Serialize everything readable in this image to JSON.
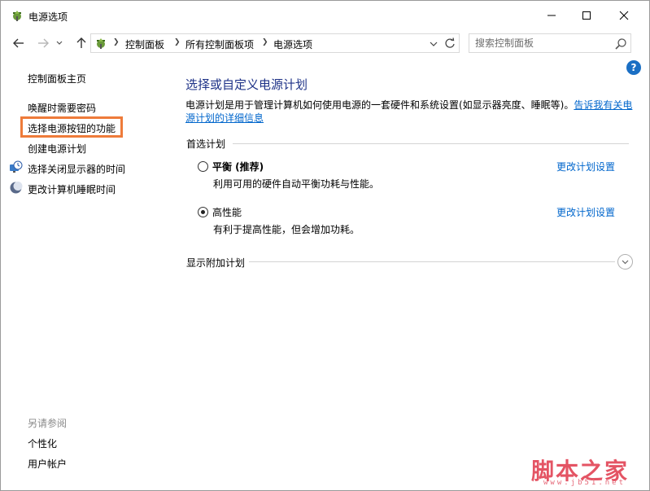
{
  "window": {
    "title": "电源选项",
    "controls": {
      "minimize": "—",
      "maximize": "☐",
      "close": "✕"
    }
  },
  "nav": {
    "breadcrumbs": [
      "控制面板",
      "所有控制面板项",
      "电源选项"
    ],
    "search_placeholder": "搜索控制面板"
  },
  "help": {
    "label": "?"
  },
  "sidebar": {
    "home": "控制面板主页",
    "links": [
      {
        "label": "唤醒时需要密码"
      },
      {
        "label": "选择电源按钮的功能"
      },
      {
        "label": "创建电源计划"
      },
      {
        "label": "选择关闭显示器的时间",
        "icon": "monitor-clock-icon"
      },
      {
        "label": "更改计算机睡眠时间",
        "icon": "moon-icon"
      }
    ],
    "see_also": {
      "heading": "另请参阅",
      "links": [
        "个性化",
        "用户帐户"
      ]
    }
  },
  "main": {
    "title": "选择或自定义电源计划",
    "description": "电源计划是用于管理计算机如何使用电源的一套硬件和系统设置(如显示器亮度、睡眠等)。",
    "description_link": "告诉我有关电源计划的详细信息",
    "preferred_label": "首选计划",
    "plans": [
      {
        "name": "平衡 (推荐)",
        "description": "利用可用的硬件自动平衡功耗与性能。",
        "link": "更改计划设置",
        "selected": false
      },
      {
        "name": "高性能",
        "description": "有利于提高性能，但会增加功耗。",
        "link": "更改计划设置",
        "selected": true
      }
    ],
    "additional_label": "显示附加计划"
  },
  "watermark": {
    "top": "脚本之家",
    "bottom": "www.jb51.net"
  },
  "colors": {
    "title_blue": "#1e3287",
    "link_blue": "#0066cc",
    "highlight_orange": "#ee7b3a",
    "watermark_red": "#e0374a"
  }
}
